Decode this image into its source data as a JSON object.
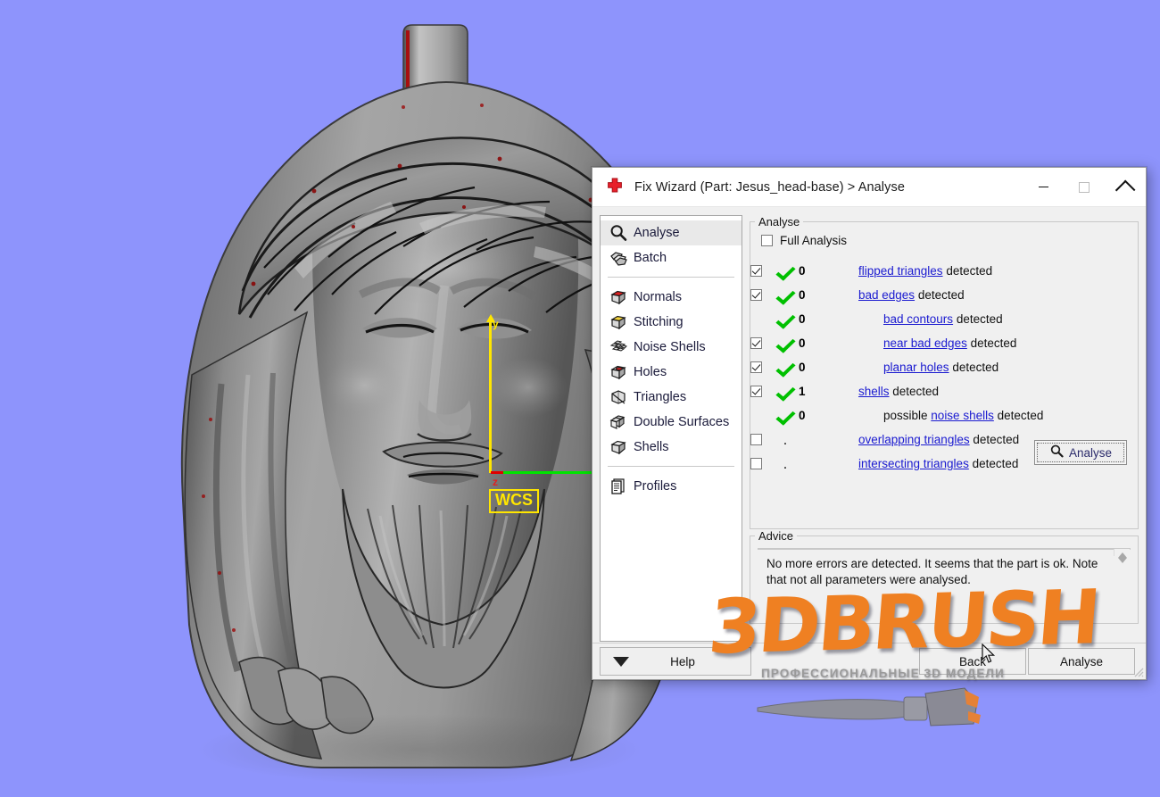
{
  "background_color": "#8e94fc",
  "viewport": {
    "model_name": "Jesus head pendant 3D relief model",
    "wcs": {
      "label": "WCS",
      "axis_y_label": "y",
      "axis_z_label": "z",
      "axis_y_color": "#ffe600",
      "axis_x_color": "#00e400",
      "axis_z_color": "#e00000"
    }
  },
  "dialog": {
    "title": "Fix Wizard (Part: Jesus_head-base) > Analyse",
    "icon": "red-cross-icon",
    "window_buttons": {
      "minimize": "minimize-button",
      "maximize": "maximize-button",
      "close": "close-button"
    },
    "nav": {
      "group1": [
        {
          "label": "Analyse",
          "icon": "magnifier-icon",
          "active": true
        },
        {
          "label": "Batch",
          "icon": "stack-icon",
          "active": false
        }
      ],
      "group2": [
        {
          "label": "Normals",
          "icon": "cube-red-top-icon",
          "active": false
        },
        {
          "label": "Stitching",
          "icon": "cube-yellow-top-icon",
          "active": false
        },
        {
          "label": "Noise Shells",
          "icon": "noise-cluster-icon",
          "active": false
        },
        {
          "label": "Holes",
          "icon": "cube-hole-icon",
          "active": false
        },
        {
          "label": "Triangles",
          "icon": "cube-triangles-icon",
          "active": false
        },
        {
          "label": "Double Surfaces",
          "icon": "double-cube-icon",
          "active": false
        },
        {
          "label": "Shells",
          "icon": "cube-icon",
          "active": false
        }
      ],
      "group3": [
        {
          "label": "Profiles",
          "icon": "document-list-icon",
          "active": false
        }
      ]
    },
    "analyse_group": {
      "legend": "Analyse",
      "full_analysis": {
        "label": "Full Analysis",
        "checked": false
      },
      "rows": [
        {
          "checkbox": true,
          "checked": true,
          "status": "check",
          "count": "0",
          "indent": 0,
          "prefix": "",
          "link": "flipped triangles",
          "suffix": " detected"
        },
        {
          "checkbox": true,
          "checked": true,
          "status": "check",
          "count": "0",
          "indent": 0,
          "prefix": "",
          "link": "bad edges",
          "suffix": " detected"
        },
        {
          "checkbox": false,
          "checked": false,
          "status": "check",
          "count": "0",
          "indent": 1,
          "prefix": "",
          "link": "bad contours",
          "suffix": " detected"
        },
        {
          "checkbox": true,
          "checked": true,
          "status": "check",
          "count": "0",
          "indent": 1,
          "prefix": "",
          "link": "near bad edges",
          "suffix": " detected"
        },
        {
          "checkbox": true,
          "checked": true,
          "status": "check",
          "count": "0",
          "indent": 1,
          "prefix": "",
          "link": "planar holes",
          "suffix": " detected"
        },
        {
          "checkbox": true,
          "checked": true,
          "status": "check",
          "count": "1",
          "indent": 0,
          "prefix": "",
          "link": "shells",
          "suffix": " detected"
        },
        {
          "checkbox": false,
          "checked": false,
          "status": "check",
          "count": "0",
          "indent": 1,
          "prefix": "possible ",
          "link": "noise shells",
          "suffix": " detected"
        },
        {
          "checkbox": true,
          "checked": false,
          "status": "dot",
          "count": "",
          "indent": 0,
          "prefix": "",
          "link": "overlapping triangles",
          "suffix": " detected"
        },
        {
          "checkbox": true,
          "checked": false,
          "status": "dot",
          "count": "",
          "indent": 0,
          "prefix": "",
          "link": "intersecting triangles",
          "suffix": " detected"
        }
      ],
      "analyse_button": {
        "label": "Analyse",
        "icon": "magnifier-icon"
      }
    },
    "advice_group": {
      "legend": "Advice",
      "text": "No more errors are detected. It seems that the part is ok. Note that not all parameters were analysed.",
      "scroll_up": "scroll-up-arrow",
      "scroll_down": "scroll-down-arrow"
    },
    "bottom_bar": {
      "dropdown_icon": "caret-down-icon",
      "help_label": "Help",
      "back_label": "Back",
      "analyse_label": "Analyse"
    }
  },
  "watermark": {
    "text": "3DBRUSH",
    "subtitle": "ПРОФЕССИОНАЛЬНЫЕ 3D МОДЕЛИ",
    "color": "#ef8022"
  }
}
